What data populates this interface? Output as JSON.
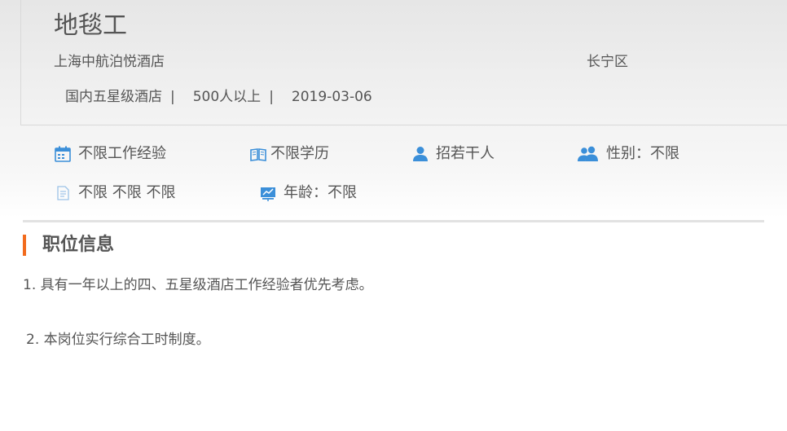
{
  "job": {
    "title": "地毯工",
    "company": "上海中航泊悦酒店",
    "district": "长宁区",
    "meta": {
      "company_type": "国内五星级酒店",
      "company_size": "500人以上",
      "date": "2019-03-06",
      "separator": "|"
    }
  },
  "requirements": [
    {
      "icon": "calendar-icon",
      "label": "不限工作经验"
    },
    {
      "icon": "book-icon",
      "label": "不限学历"
    },
    {
      "icon": "person-icon",
      "label": "招若干人"
    },
    {
      "icon": "people-icon",
      "label": "性别：不限"
    },
    {
      "icon": "document-icon",
      "label": "不限 不限 不限"
    },
    {
      "icon": "presentation-icon",
      "label": "年龄：不限"
    }
  ],
  "section": {
    "title": "职位信息",
    "accent_color": "#f26b1d"
  },
  "description": [
    "1. 具有一年以上的四、五星级酒店工作经验者优先考虑。",
    "2. 本岗位实行综合工时制度。"
  ],
  "icon_color": "#3b8fd9"
}
